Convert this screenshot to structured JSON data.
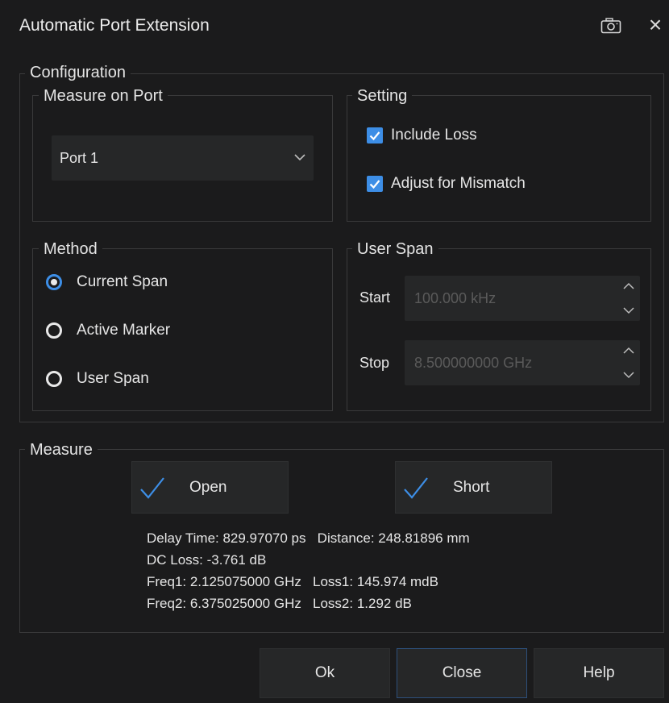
{
  "dialog": {
    "title": "Automatic Port Extension"
  },
  "configuration": {
    "label": "Configuration",
    "measure_on_port": {
      "label": "Measure on Port",
      "selected": "Port 1"
    },
    "setting": {
      "label": "Setting",
      "include_loss": {
        "label": "Include Loss",
        "checked": true
      },
      "adjust_mismatch": {
        "label": "Adjust for Mismatch",
        "checked": true
      }
    },
    "method": {
      "label": "Method",
      "options": [
        {
          "label": "Current Span",
          "selected": true
        },
        {
          "label": "Active Marker",
          "selected": false
        },
        {
          "label": "User Span",
          "selected": false
        }
      ]
    },
    "user_span": {
      "label": "User Span",
      "start": {
        "label": "Start",
        "value": "100.000 kHz"
      },
      "stop": {
        "label": "Stop",
        "value": "8.500000000 GHz"
      }
    }
  },
  "measure": {
    "label": "Measure",
    "open_label": "Open",
    "short_label": "Short",
    "results": {
      "line1": "Delay Time: 829.97070 ps   Distance: 248.81896 mm",
      "line2": "DC Loss: -3.761 dB",
      "line3": "Freq1: 2.125075000 GHz   Loss1: 145.974 mdB",
      "line4": "Freq2: 6.375025000 GHz   Loss2: 1.292 dB"
    }
  },
  "footer": {
    "ok": "Ok",
    "close": "Close",
    "help": "Help"
  },
  "colors": {
    "accent": "#3d8ee6",
    "background": "#1b1b1c",
    "control": "#262728"
  },
  "icons": {
    "camera": "camera-icon",
    "close": "close-icon"
  }
}
